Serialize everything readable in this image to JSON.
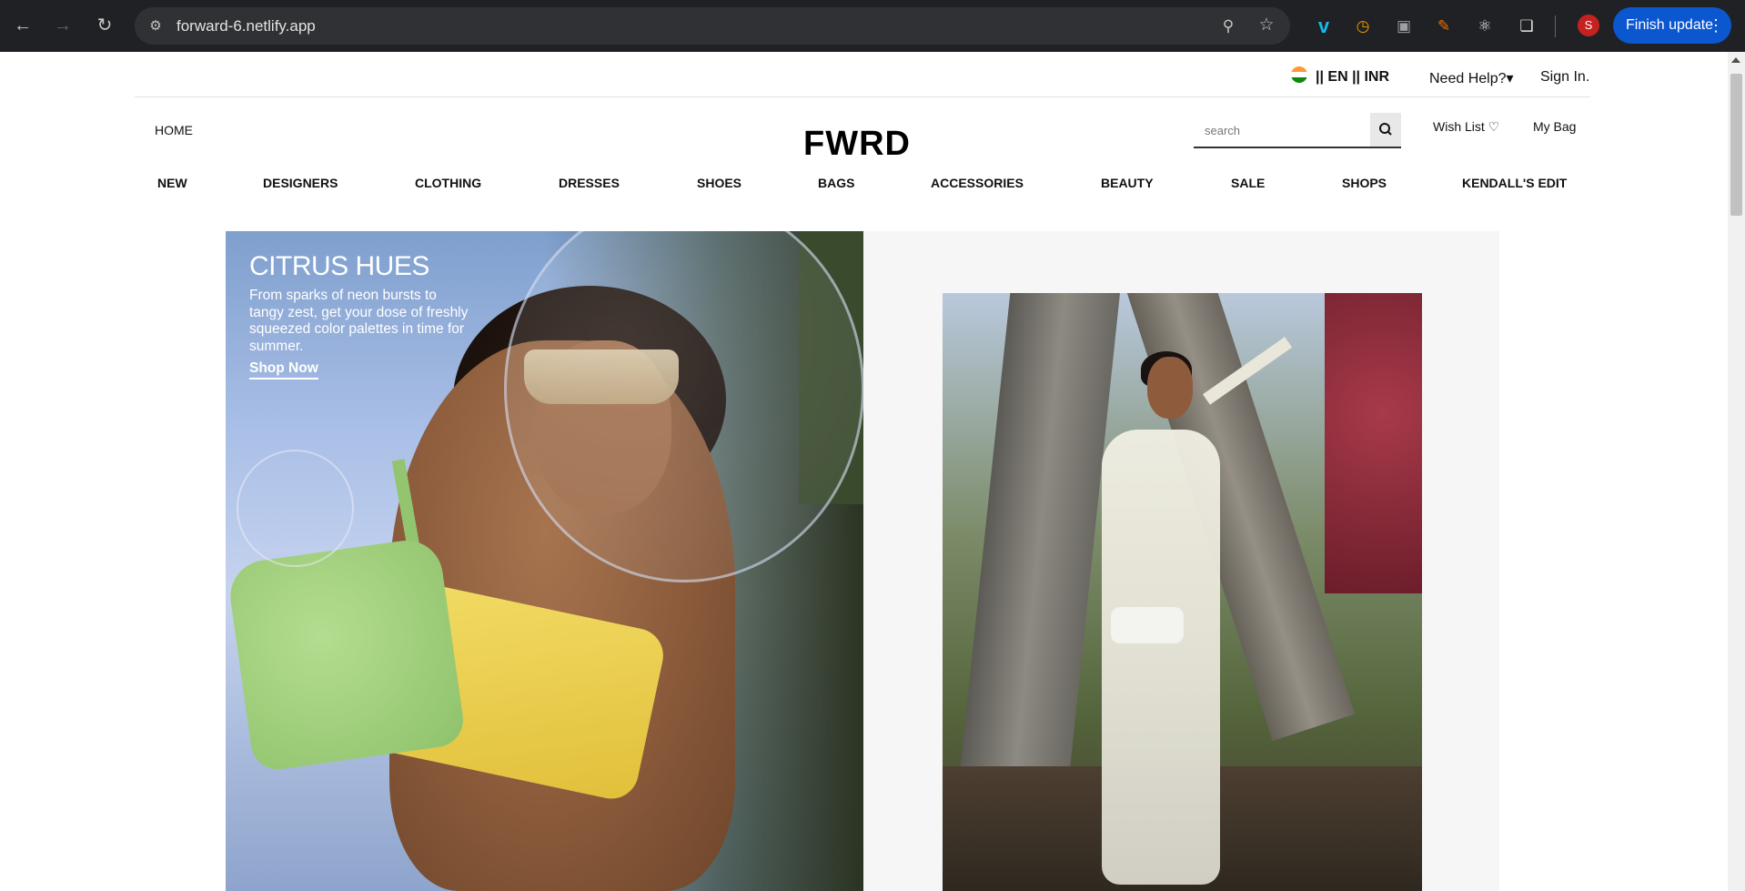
{
  "browser": {
    "url": "forward-6.netlify.app",
    "update_label": "Finish update",
    "avatar_initial": "S",
    "extensions": [
      "vimeo-icon",
      "timer-icon",
      "image-icon",
      "pen-icon",
      "react-icon",
      "puzzle-icon"
    ]
  },
  "topbar": {
    "locale": "|| EN || INR",
    "help": "Need Help?▾",
    "signin": "Sign In."
  },
  "header": {
    "home": "HOME",
    "logo": "FWRD",
    "search_placeholder": "search",
    "wishlist": "Wish List ♡",
    "bag": "My Bag"
  },
  "nav": [
    "NEW",
    "DESIGNERS",
    "CLOTHING",
    "DRESSES",
    "SHOES",
    "BAGS",
    "ACCESSORIES",
    "BEAUTY",
    "SALE",
    "SHOPS",
    "KENDALL'S EDIT"
  ],
  "hero": {
    "title": "CITRUS HUES",
    "text": "From sparks of neon bursts to tangy zest, get your dose of freshly squeezed color palettes in time for summer.",
    "cta": "Shop Now"
  },
  "colors": {
    "chrome_bg": "#202124",
    "update_btn": "#0b57d0",
    "flag_saffron": "#ff9933",
    "flag_green": "#138808"
  }
}
